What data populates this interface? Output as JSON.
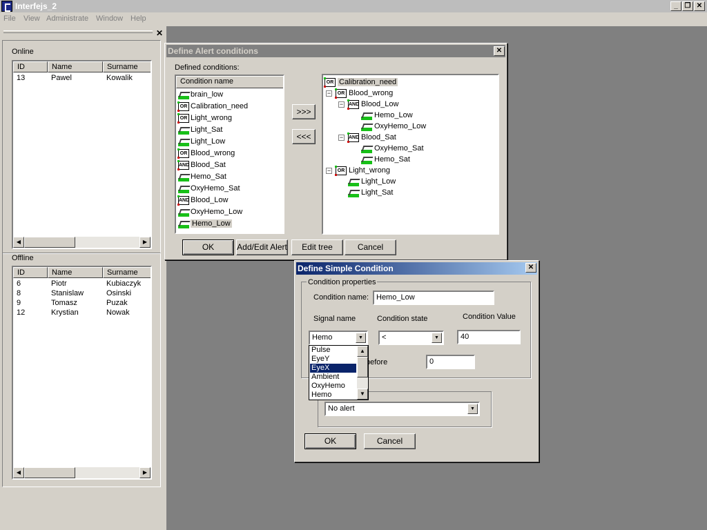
{
  "app": {
    "title": "Interfejs_2",
    "window_buttons": [
      "_",
      "❒",
      "✕"
    ]
  },
  "menu": [
    "File",
    "View",
    "Administrate",
    "Window",
    "Help"
  ],
  "left_panel": {
    "close": "✕",
    "online": {
      "label": "Online",
      "columns": [
        "ID",
        "Name",
        "Surname"
      ],
      "rows": [
        [
          "13",
          "Pawel",
          "Kowalik"
        ]
      ]
    },
    "offline": {
      "label": "Offline",
      "columns": [
        "ID",
        "Name",
        "Surname"
      ],
      "rows": [
        [
          "6",
          "Piotr",
          "Kubiaczyk"
        ],
        [
          "8",
          "Stanislaw",
          "Osinski"
        ],
        [
          "9",
          "Tomasz",
          "Puzak"
        ],
        [
          "12",
          "Krystian",
          "Nowak"
        ]
      ]
    }
  },
  "alert_dialog": {
    "title": "Define Alert conditions",
    "close": "✕",
    "defined_label": "Defined conditions:",
    "list_header": "Condition name",
    "conditions": [
      {
        "label": "brain_low",
        "icon": "wave"
      },
      {
        "label": "Calibration_need",
        "icon": "or"
      },
      {
        "label": "Light_wrong",
        "icon": "or"
      },
      {
        "label": "Light_Sat",
        "icon": "wave"
      },
      {
        "label": "Light_Low",
        "icon": "wave"
      },
      {
        "label": "Blood_wrong",
        "icon": "or"
      },
      {
        "label": "Blood_Sat",
        "icon": "and"
      },
      {
        "label": "Hemo_Sat",
        "icon": "wave"
      },
      {
        "label": "OxyHemo_Sat",
        "icon": "wave"
      },
      {
        "label": "Blood_Low",
        "icon": "and"
      },
      {
        "label": "OxyHemo_Low",
        "icon": "wave"
      },
      {
        "label": "Hemo_Low",
        "icon": "wave"
      }
    ],
    "selected_condition": "Hemo_Low",
    "add_button": ">>>",
    "remove_button": "<<<",
    "tree": [
      {
        "label": "Calibration_need",
        "icon": "or",
        "level": 0,
        "expander": ""
      },
      {
        "label": "Blood_wrong",
        "icon": "or",
        "level": 0,
        "expander": "−"
      },
      {
        "label": "Blood_Low",
        "icon": "and",
        "level": 1,
        "expander": "−"
      },
      {
        "label": "Hemo_Low",
        "icon": "wave",
        "level": 2,
        "expander": ""
      },
      {
        "label": "OxyHemo_Low",
        "icon": "wave",
        "level": 2,
        "expander": ""
      },
      {
        "label": "Blood_Sat",
        "icon": "and",
        "level": 1,
        "expander": "−"
      },
      {
        "label": "OxyHemo_Sat",
        "icon": "wave",
        "level": 2,
        "expander": ""
      },
      {
        "label": "Hemo_Sat",
        "icon": "wave",
        "level": 2,
        "expander": ""
      },
      {
        "label": "Light_wrong",
        "icon": "or",
        "level": 0,
        "expander": "−"
      },
      {
        "label": "Light_Low",
        "icon": "wave",
        "level": 1,
        "expander": ""
      },
      {
        "label": "Light_Sat",
        "icon": "wave",
        "level": 1,
        "expander": ""
      }
    ],
    "buttons": {
      "ok": "OK",
      "add_edit": "Add/Edit Alert",
      "edit_tree": "Edit tree",
      "cancel": "Cancel"
    }
  },
  "simple_dialog": {
    "title": "Define Simple Condition",
    "close": "✕",
    "properties_legend": "Condition properties",
    "name_label": "Condition name:",
    "name_value": "Hemo_Low",
    "signal_label": "Signal name",
    "state_label": "Condition state",
    "value_label": "Condition Value",
    "signal_value": "Hemo",
    "state_value": "<",
    "condition_value": "40",
    "before_label": "before",
    "before_value": "0",
    "alert_value": "No alert",
    "signal_options": [
      "Pulse",
      "EyeY",
      "EyeX",
      "Ambient",
      "OxyHemo",
      "Hemo"
    ],
    "highlighted_option": "EyeX",
    "buttons": {
      "ok": "OK",
      "cancel": "Cancel"
    }
  },
  "colors": {
    "active_title_start": "#0a246a",
    "active_title_end": "#a6caf0",
    "inactive_title": "#808080",
    "face": "#d4d0c8",
    "desktop": "#808080",
    "selection": "#0a246a"
  }
}
